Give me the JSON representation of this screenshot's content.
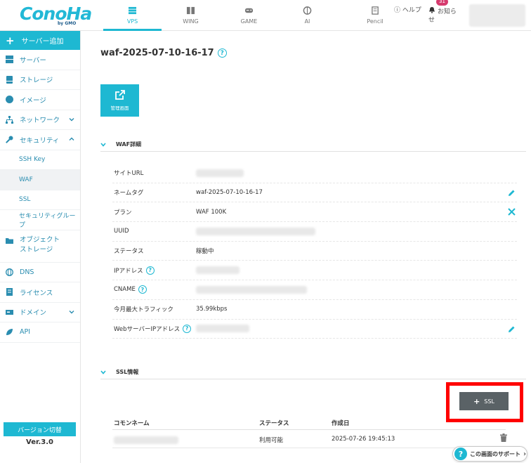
{
  "header": {
    "logo": "ConoHa",
    "logo_sub": "by GMO",
    "nav": [
      {
        "label": "VPS",
        "icon": "server-stack-icon",
        "active": true
      },
      {
        "label": "WING",
        "icon": "building-icon",
        "active": false
      },
      {
        "label": "GAME",
        "icon": "gamepad-icon",
        "active": false
      },
      {
        "label": "AI",
        "icon": "brain-icon",
        "active": false
      },
      {
        "label": "Pencil",
        "icon": "pencil-doc-icon",
        "active": false
      }
    ],
    "help_label": "ヘルプ",
    "notice_label": "お知らせ",
    "notice_count": "31"
  },
  "sidebar": {
    "add_label": "サーバー追加",
    "items": [
      {
        "label": "サーバー",
        "icon": "server-icon"
      },
      {
        "label": "ストレージ",
        "icon": "storage-icon"
      },
      {
        "label": "イメージ",
        "icon": "globe-icon"
      },
      {
        "label": "ネットワーク",
        "icon": "network-icon"
      },
      {
        "label": "セキュリティ",
        "icon": "key-icon"
      },
      {
        "label": "SSH Key"
      },
      {
        "label": "WAF"
      },
      {
        "label": "SSL"
      },
      {
        "label": "セキュリティグループ"
      },
      {
        "label": "オブジェクト\nストレージ",
        "icon": "folder-icon"
      },
      {
        "label": "DNS",
        "icon": "globe-icon"
      },
      {
        "label": "ライセンス",
        "icon": "license-icon"
      },
      {
        "label": "ドメイン",
        "icon": "domain-icon"
      },
      {
        "label": "API",
        "icon": "leaf-icon"
      }
    ],
    "version_button": "バージョン切替",
    "version_text": "Ver.3.0"
  },
  "main": {
    "title": "waf-2025-07-10-16-17",
    "manage_button": "管理画面",
    "waf_section": "WAF詳細",
    "details": [
      {
        "label": "サイトURL",
        "value": ""
      },
      {
        "label": "ネームタグ",
        "value": "waf-2025-07-10-16-17"
      },
      {
        "label": "プラン",
        "value": "WAF 100K"
      },
      {
        "label": "UUID",
        "value": ""
      },
      {
        "label": "ステータス",
        "value": "稼動中"
      },
      {
        "label": "IPアドレス",
        "value": ""
      },
      {
        "label": "CNAME",
        "value": ""
      },
      {
        "label": "今月最大トラフィック",
        "value": "35.99kbps"
      },
      {
        "label": "WebサーバーIPアドレス",
        "value": ""
      }
    ],
    "ssl_section": "SSL情報",
    "ssl_button": "SSL",
    "ssl_columns": [
      "コモンネーム",
      "ステータス",
      "作成日"
    ],
    "ssl_rows": [
      {
        "common_name": "",
        "status": "利用可能",
        "created": "2025-07-26 19:45:13"
      }
    ],
    "support_label": "この画面のサポート",
    "support_arrow": "›"
  },
  "colors": {
    "accent": "#1eb8d2",
    "link": "#2a8db0",
    "highlight": "#ff0000",
    "ssl_button": "#5a6266"
  }
}
